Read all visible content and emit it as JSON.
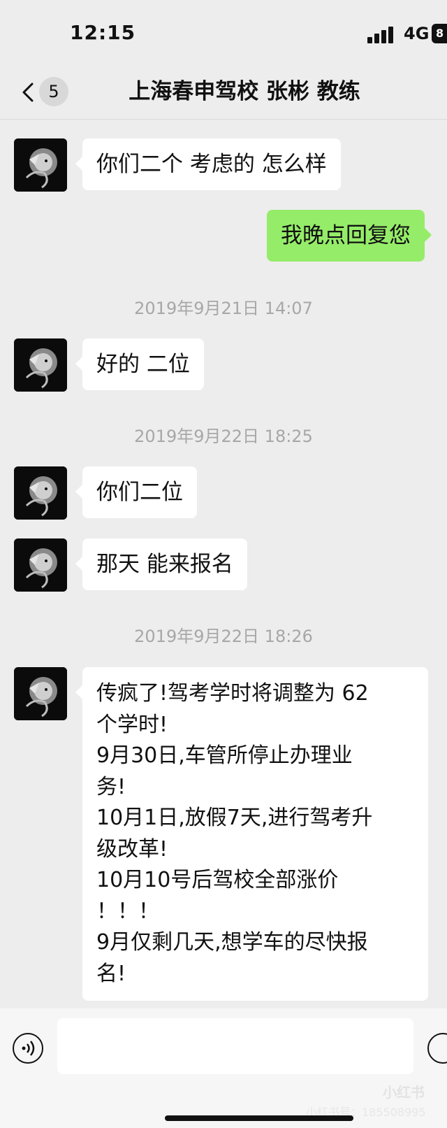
{
  "status": {
    "time": "12:15",
    "network": "4G",
    "battery": "8"
  },
  "nav": {
    "unread_count": "5",
    "title": "上海春申驾校 张彬 教练"
  },
  "messages": [
    {
      "text": "你们二个 考虑的 怎么样"
    },
    {
      "text": "我晚点回复您"
    },
    {
      "text": "好的 二位"
    },
    {
      "text": "你们二位"
    },
    {
      "text": "那天 能来报名"
    },
    {
      "text": "传疯了!驾考学时将调整为 62\n个学时!\n9月30日,车管所停止办理业\n务!\n10月1日,放假7天,进行驾考升\n级改革!\n10月10号后驾校全部涨价\n！！！\n9月仅剩几天,想学车的尽快报\n名!"
    }
  ],
  "timestamps": [
    "2019年9月21日 14:07",
    "2019年9月22日 18:25",
    "2019年9月22日 18:26"
  ],
  "watermark": {
    "logo": "小红书",
    "text": "小红书号：185508995"
  },
  "colors": {
    "sent_bubble": "#95ec69",
    "received_bubble": "#ffffff",
    "background": "#ededed"
  },
  "icons": {
    "back": "chevron-left-icon",
    "voice": "voice-icon",
    "emoji": "emoji-icon",
    "avatar": "lion-avatar"
  }
}
